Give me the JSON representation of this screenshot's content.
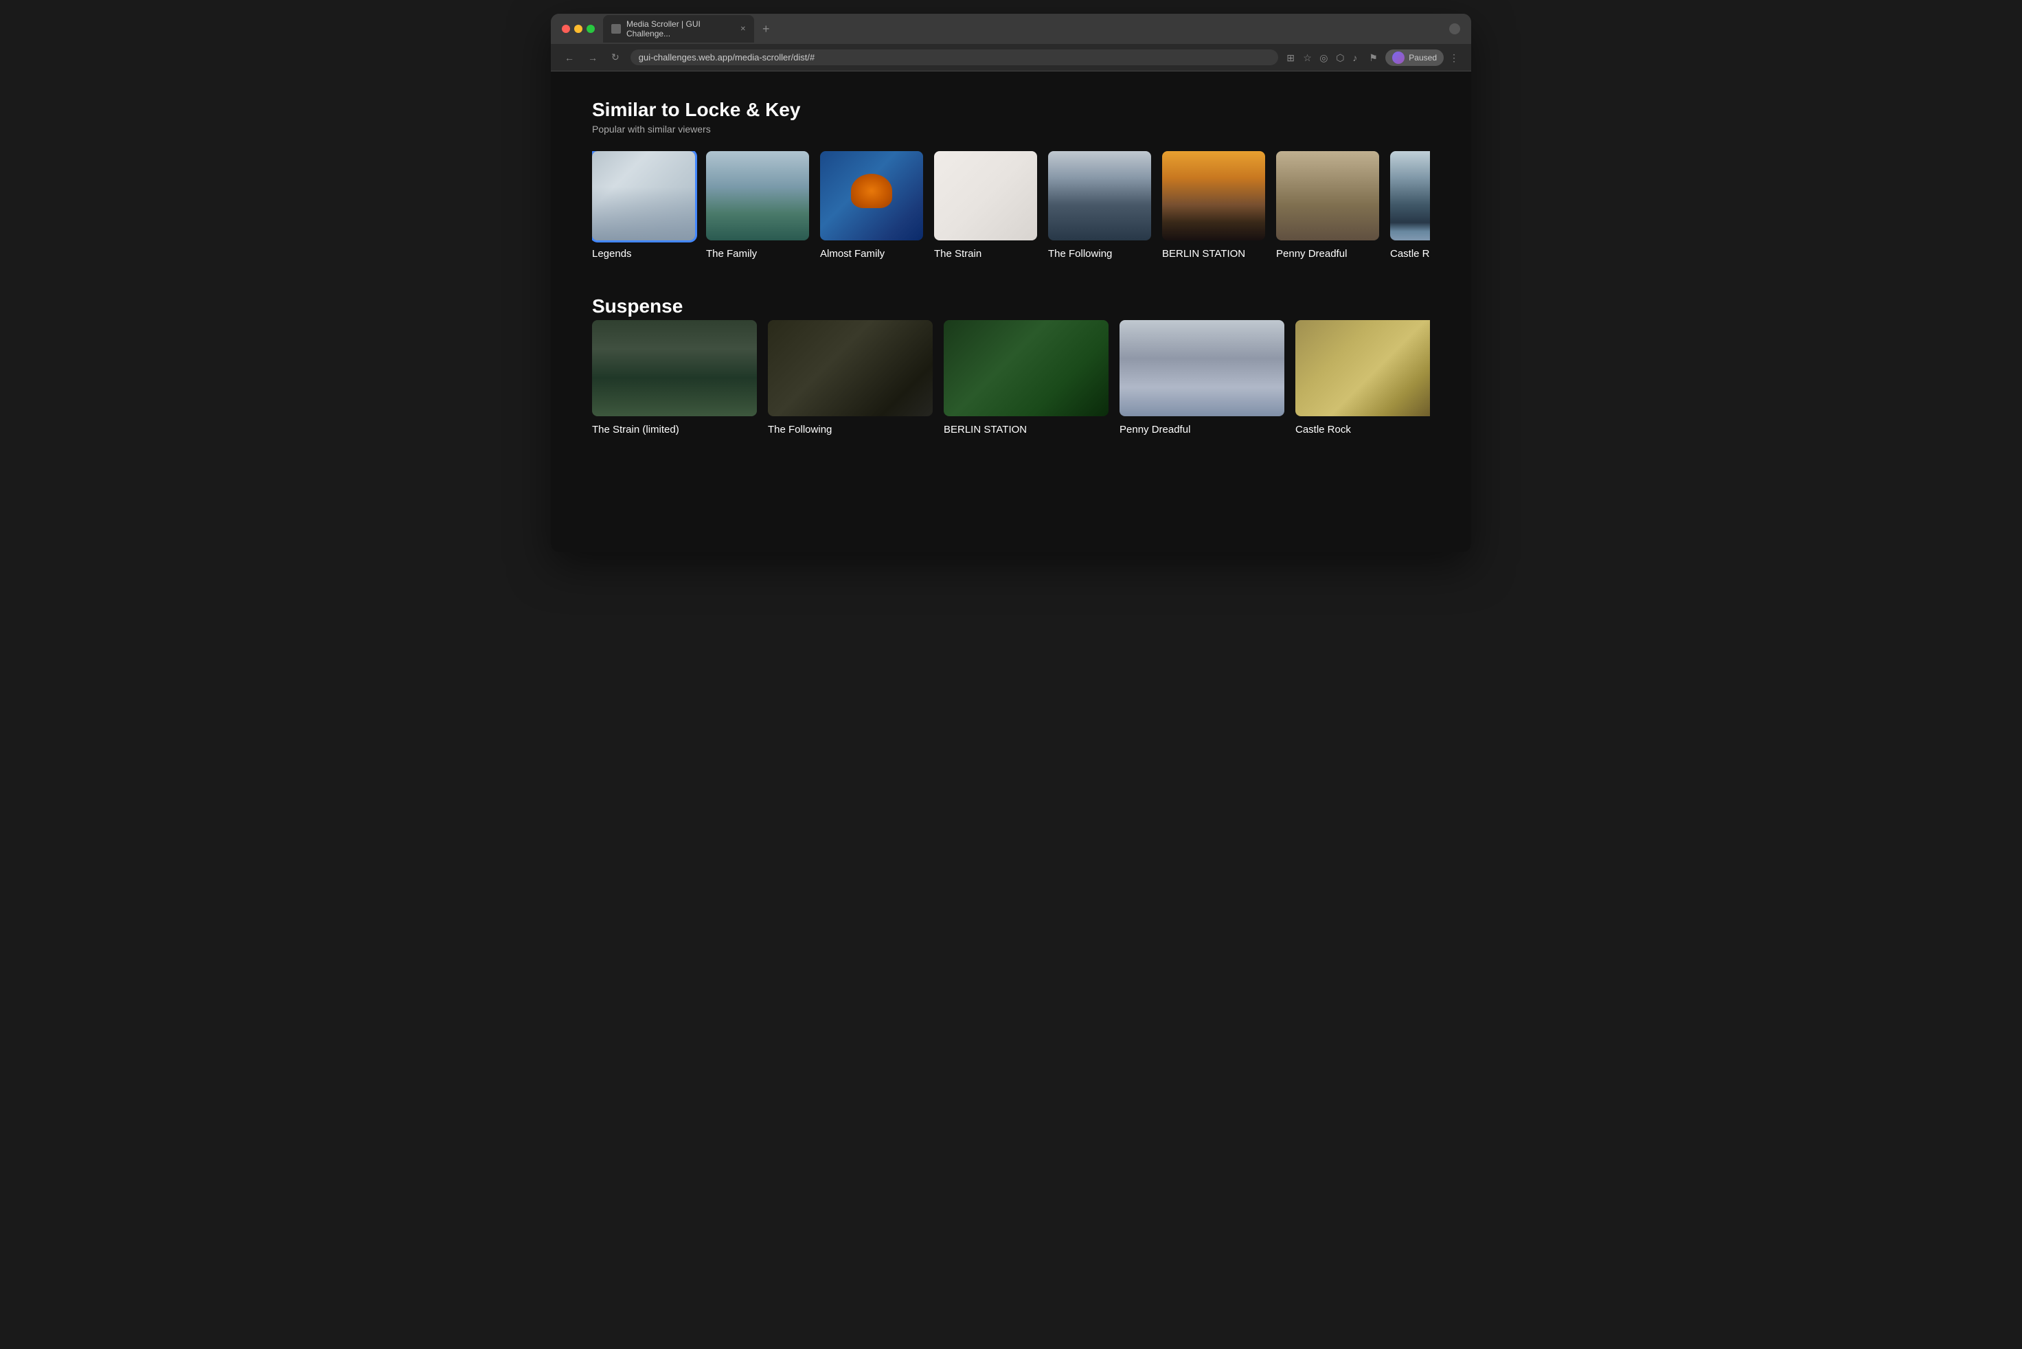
{
  "browser": {
    "tab_title": "Media Scroller | GUI Challenge...",
    "url": "gui-challenges.web.app/media-scroller/dist/#",
    "new_tab_label": "+",
    "paused_label": "Paused",
    "nav": {
      "back": "←",
      "forward": "→",
      "reload": "↻"
    }
  },
  "similar_section": {
    "title": "Similar to Locke & Key",
    "subtitle": "Popular with similar viewers",
    "items": [
      {
        "id": "legends",
        "label": "Legends",
        "thumb": "grand-central",
        "selected": true
      },
      {
        "id": "the-family",
        "label": "The Family",
        "thumb": "aerial-city",
        "selected": false
      },
      {
        "id": "almost-family",
        "label": "Almost Family",
        "thumb": "jellyfish",
        "selected": false
      },
      {
        "id": "the-strain",
        "label": "The Strain",
        "thumb": "food",
        "selected": false
      },
      {
        "id": "the-following",
        "label": "The Following",
        "thumb": "mountain",
        "selected": false
      },
      {
        "id": "berlin-station",
        "label": "BERLIN STATION",
        "thumb": "sunset",
        "selected": false
      },
      {
        "id": "penny-dreadful",
        "label": "Penny Dreadful",
        "thumb": "reed",
        "selected": false
      },
      {
        "id": "castle-rock",
        "label": "Castle Rock",
        "thumb": "ocean",
        "selected": false
      }
    ]
  },
  "suspense_section": {
    "title": "Suspense",
    "items": [
      {
        "id": "strain-limited",
        "label": "The Strain (limited)",
        "thumb": "fog"
      },
      {
        "id": "the-following-2",
        "label": "The Following",
        "thumb": "tools"
      },
      {
        "id": "berlin-station-2",
        "label": "BERLIN STATION",
        "thumb": "plants"
      },
      {
        "id": "penny-dreadful-2",
        "label": "Penny Dreadful",
        "thumb": "rain"
      },
      {
        "id": "castle-rock-2",
        "label": "Castle Rock",
        "thumb": "silhouette"
      }
    ]
  }
}
